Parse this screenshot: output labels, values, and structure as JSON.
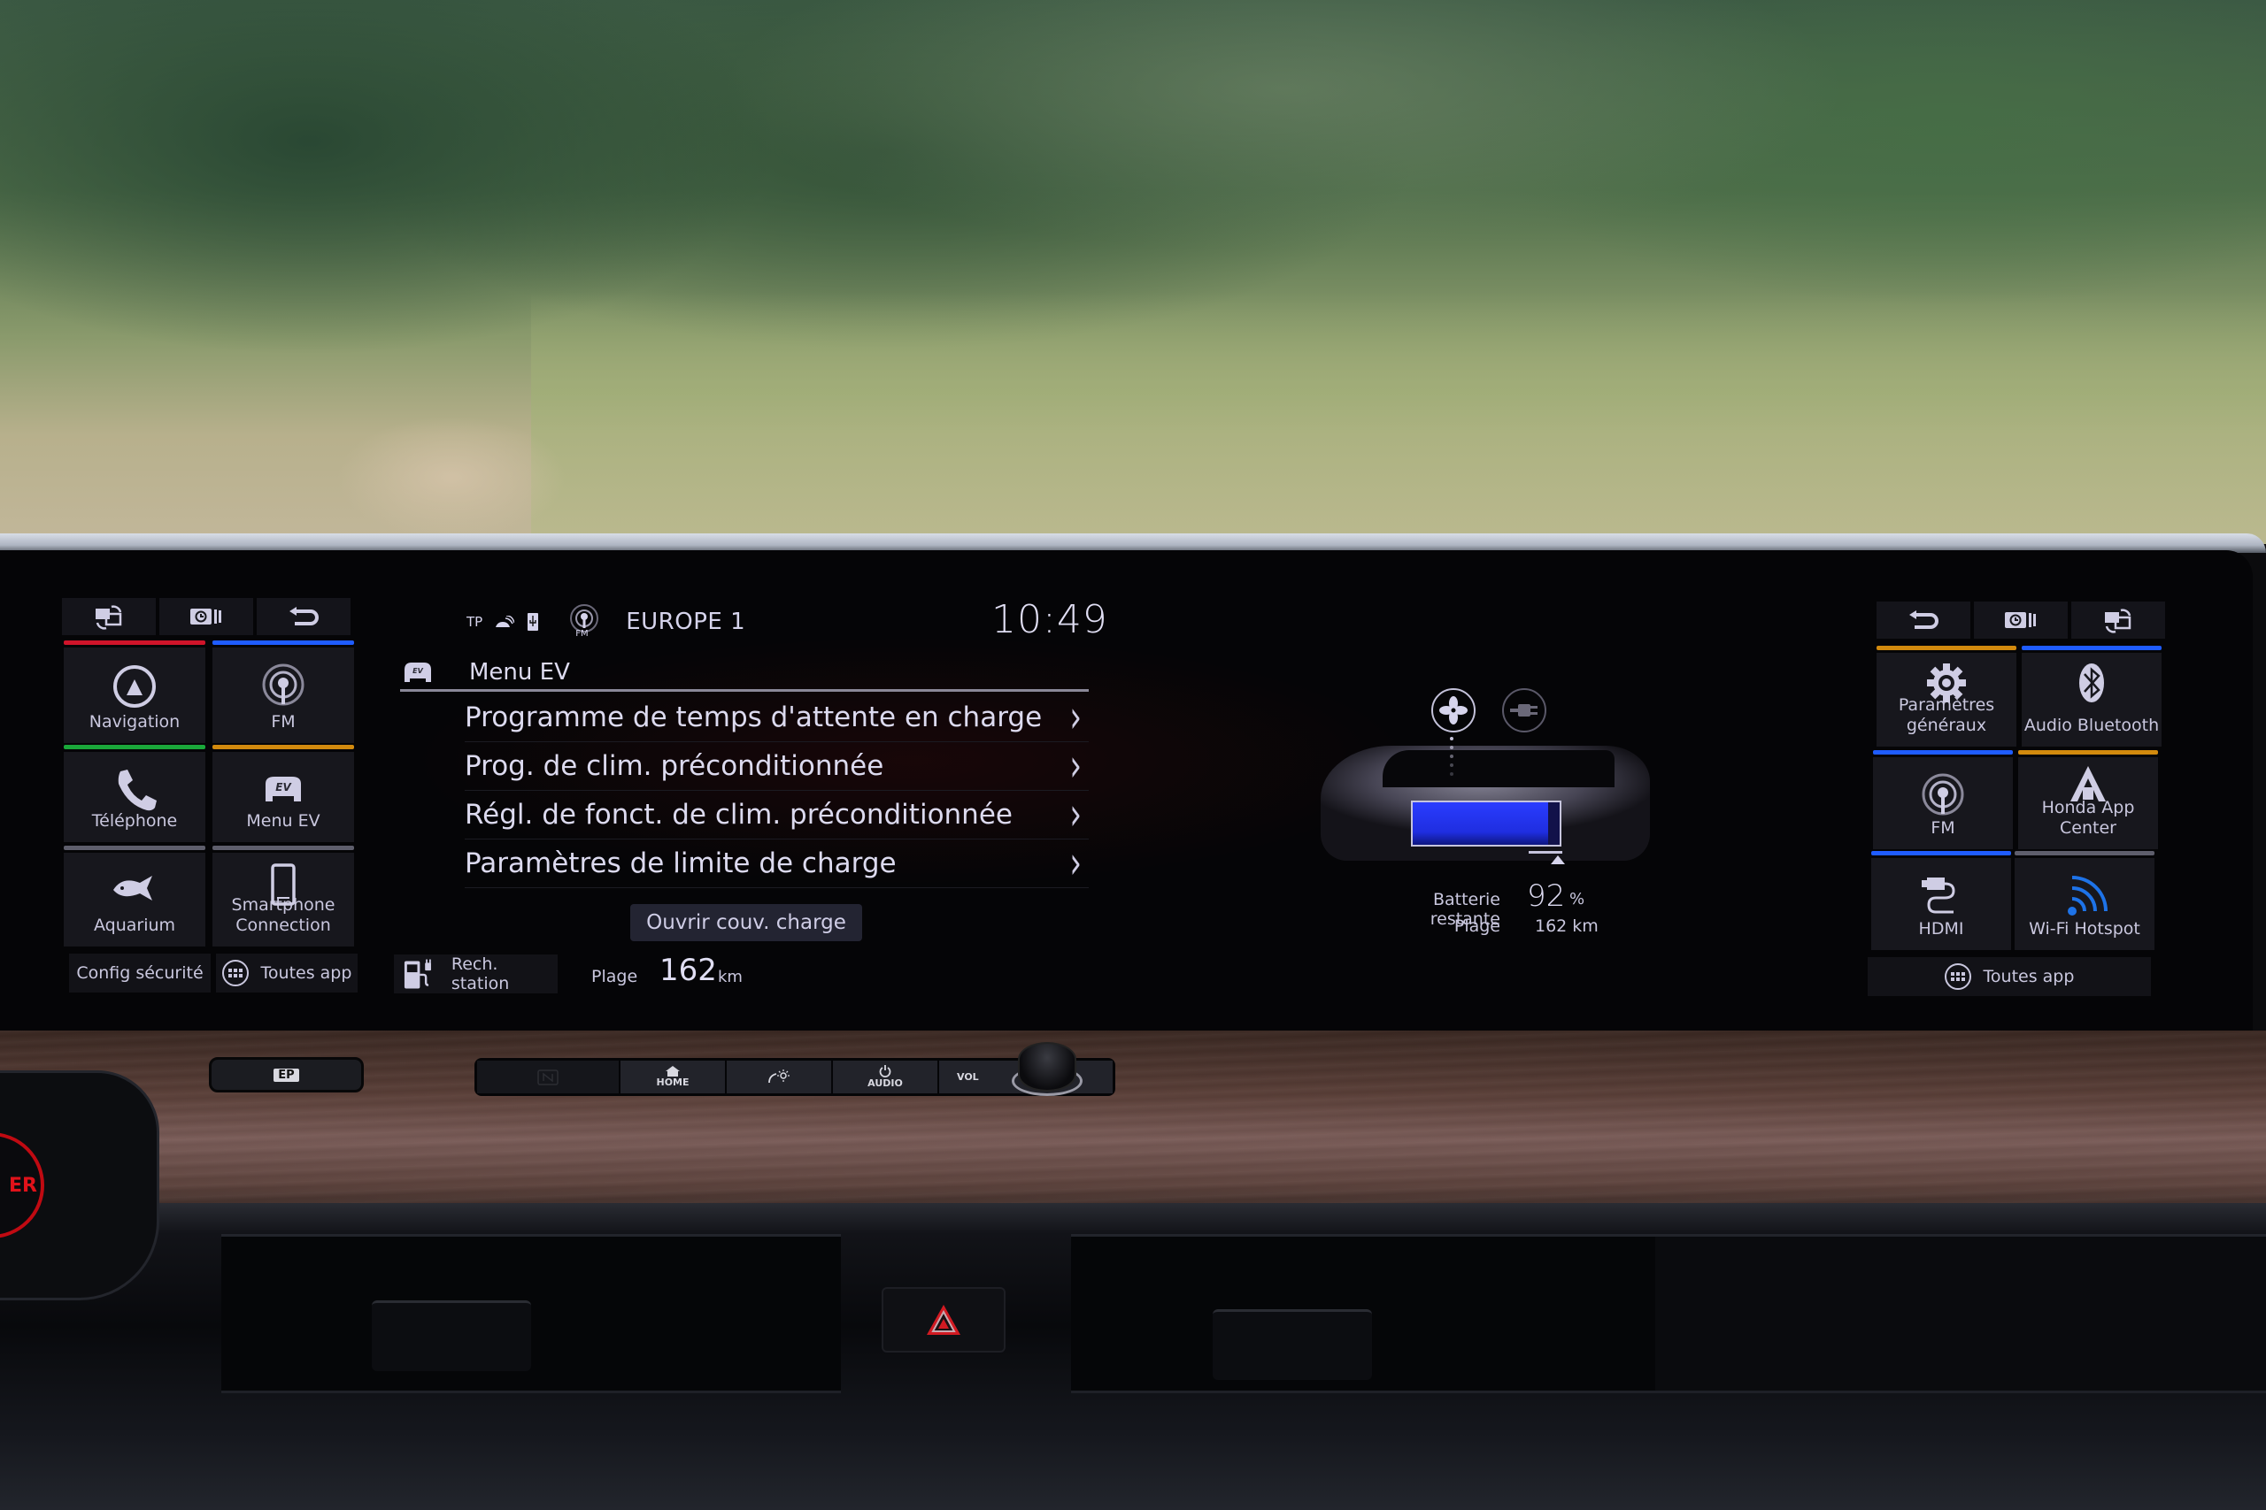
{
  "status_bar": {
    "tp_label": "TP",
    "source_badge": "FM",
    "station_name": "EUROPE 1",
    "clock": "10:49"
  },
  "left_panel": {
    "top_buttons": [
      {
        "icon": "swap-screen-icon"
      },
      {
        "icon": "history-icon"
      },
      {
        "icon": "back-icon"
      }
    ],
    "tiles": [
      {
        "label": "Navigation",
        "icon": "navigation-icon",
        "accent": "#d0142a"
      },
      {
        "label": "FM",
        "icon": "radio-icon",
        "accent": "#1f5cff"
      },
      {
        "label": "Téléphone",
        "icon": "phone-icon",
        "accent": "#1aa83a"
      },
      {
        "label": "Menu EV",
        "icon": "ev-car-icon",
        "accent": "#d28a0e"
      },
      {
        "label": "Aquarium",
        "icon": "fish-icon",
        "accent": "#5e5e6c"
      },
      {
        "label": "Smartphone Connection",
        "icon": "smartphone-icon",
        "accent": "#5e5e6c"
      }
    ],
    "footer": {
      "security": "Config sécurité",
      "all_apps": "Toutes app"
    }
  },
  "center": {
    "menu_title": "Menu EV",
    "menu_items": [
      "Programme de temps d'attente en charge",
      "Prog. de clim. préconditionnée",
      "Régl. de fonct. de clim. préconditionnée",
      "Paramètres de limite de charge"
    ],
    "open_charge_lid": "Ouvrir couv. charge",
    "station_search": "Rech. station",
    "range_label": "Plage",
    "range_value": "162",
    "range_unit": "km"
  },
  "ev_status": {
    "battery_label": "Batterie restante",
    "battery_percent": 92,
    "battery_value": "92",
    "battery_unit": "%",
    "range_label": "Plage",
    "range_text": "162 km",
    "climate_icon": "fan-icon",
    "charge_icon": "plug-icon",
    "battery_color": "#2233ff"
  },
  "right_panel": {
    "top_buttons": [
      {
        "icon": "back-icon"
      },
      {
        "icon": "history-icon"
      },
      {
        "icon": "swap-screen-icon"
      }
    ],
    "tiles": [
      {
        "label": "Paramètres généraux",
        "icon": "gear-icon",
        "accent": "#d28a0e"
      },
      {
        "label": "Audio Bluetooth",
        "icon": "bluetooth-icon",
        "accent": "#1f5cff"
      },
      {
        "label": "FM",
        "icon": "radio-icon",
        "accent": "#1f5cff"
      },
      {
        "label": "Honda App Center",
        "icon": "app-center-icon",
        "accent": "#d28a0e"
      },
      {
        "label": "HDMI",
        "icon": "hdmi-icon",
        "accent": "#1f5cff"
      },
      {
        "label": "Wi-Fi Hotspot",
        "icon": "wifi-icon",
        "accent": "#5e5e6c"
      }
    ],
    "footer": {
      "all_apps": "Toutes app"
    }
  },
  "hardware": {
    "ep_button": "EP",
    "home": "HOME",
    "audio": "AUDIO",
    "vol": "VOL",
    "power_fragment": "ER"
  }
}
